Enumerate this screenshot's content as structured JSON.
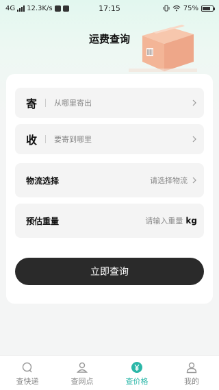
{
  "status_bar": {
    "network": "4G",
    "speed": "12.3K/s",
    "time": "17:15",
    "battery": "75%",
    "battery_level": 0.75
  },
  "header": {
    "title": "运费查询"
  },
  "form": {
    "sender": {
      "label": "寄",
      "placeholder": "从哪里寄出"
    },
    "receiver": {
      "label": "收",
      "placeholder": "要寄到哪里"
    },
    "logistics": {
      "label": "物流选择",
      "hint": "请选择物流"
    },
    "weight": {
      "label": "预估重量",
      "placeholder": "请输入重量",
      "unit": "kg"
    },
    "submit_label": "立即查询"
  },
  "tabbar": {
    "tabs": [
      {
        "label": "查快递",
        "icon": "search-icon",
        "active": false
      },
      {
        "label": "查网点",
        "icon": "location-person-icon",
        "active": false
      },
      {
        "label": "查价格",
        "icon": "yen-icon",
        "active": true
      },
      {
        "label": "我的",
        "icon": "user-icon",
        "active": false
      }
    ]
  },
  "colors": {
    "accent": "#2bb7a8",
    "button_bg": "#2a2a2a",
    "header_gradient": "#e2f7ef"
  }
}
